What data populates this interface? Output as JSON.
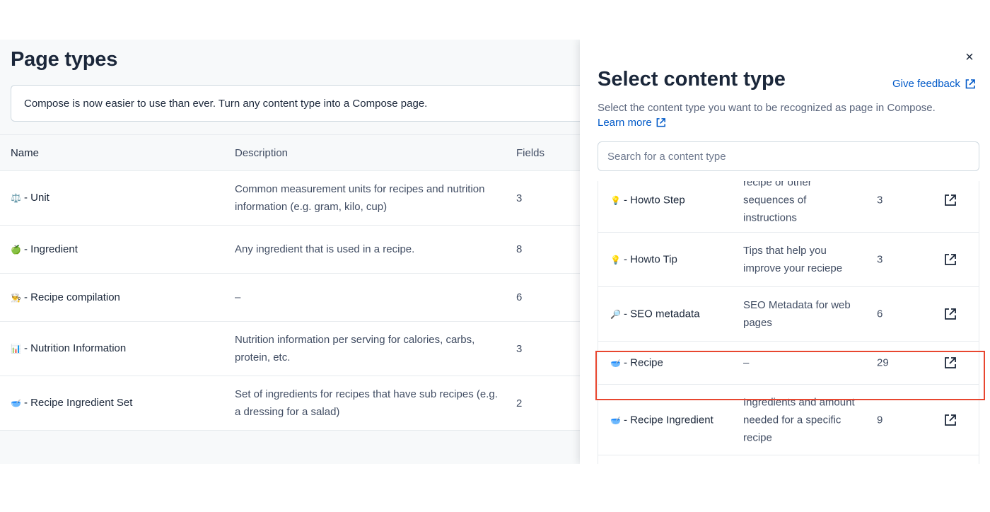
{
  "page": {
    "title": "Page types",
    "notice": "Compose is now easier to use than ever. Turn any content type into a Compose page.",
    "columns": {
      "name": "Name",
      "description": "Description",
      "fields": "Fields"
    },
    "rows": [
      {
        "icon": "⚖️",
        "name": "- Unit",
        "description": "Common measurement units for recipes and nutrition information (e.g. gram, kilo, cup)",
        "fields": "3"
      },
      {
        "icon": "🍏",
        "name": "- Ingredient",
        "description": "Any ingredient that is used in a recipe.",
        "fields": "8"
      },
      {
        "icon": "👨‍🍳",
        "name": "- Recipe compilation",
        "description": "–",
        "fields": "6"
      },
      {
        "icon": "📊",
        "name": "- Nutrition Information",
        "description": "Nutrition information per serving for calories, carbs, protein, etc.",
        "fields": "3"
      },
      {
        "icon": "🥣",
        "name": "- Recipe Ingredient Set",
        "description": "Set of ingredients for recipes that have sub recipes (e.g. a dressing for a salad)",
        "fields": "2"
      }
    ]
  },
  "panel": {
    "close": "×",
    "title": "Select content type",
    "feedback": "Give feedback",
    "description": "Select the content type you want to be recognized as page in Compose.",
    "learn_more": "Learn more",
    "search_placeholder": "Search for a content type",
    "items": [
      {
        "icon": "💡",
        "name": "- Howto Step",
        "description": "recipe or other sequences of instructions",
        "fields": "3"
      },
      {
        "icon": "💡",
        "name": "- Howto Tip",
        "description": "Tips that help you improve your reciepe",
        "fields": "3"
      },
      {
        "icon": "🔎",
        "name": "- SEO metadata",
        "description": "SEO Metadata for web pages",
        "fields": "6"
      },
      {
        "icon": "🥣",
        "name": "- Recipe",
        "description": "–",
        "fields": "29"
      },
      {
        "icon": "🥣",
        "name": "- Recipe Ingredient",
        "description": "Ingredients and amount needed for a specific recipe",
        "fields": "9"
      }
    ]
  },
  "colors": {
    "link": "#0059c8",
    "highlight": "#e8462f",
    "text": "#1b273a"
  }
}
